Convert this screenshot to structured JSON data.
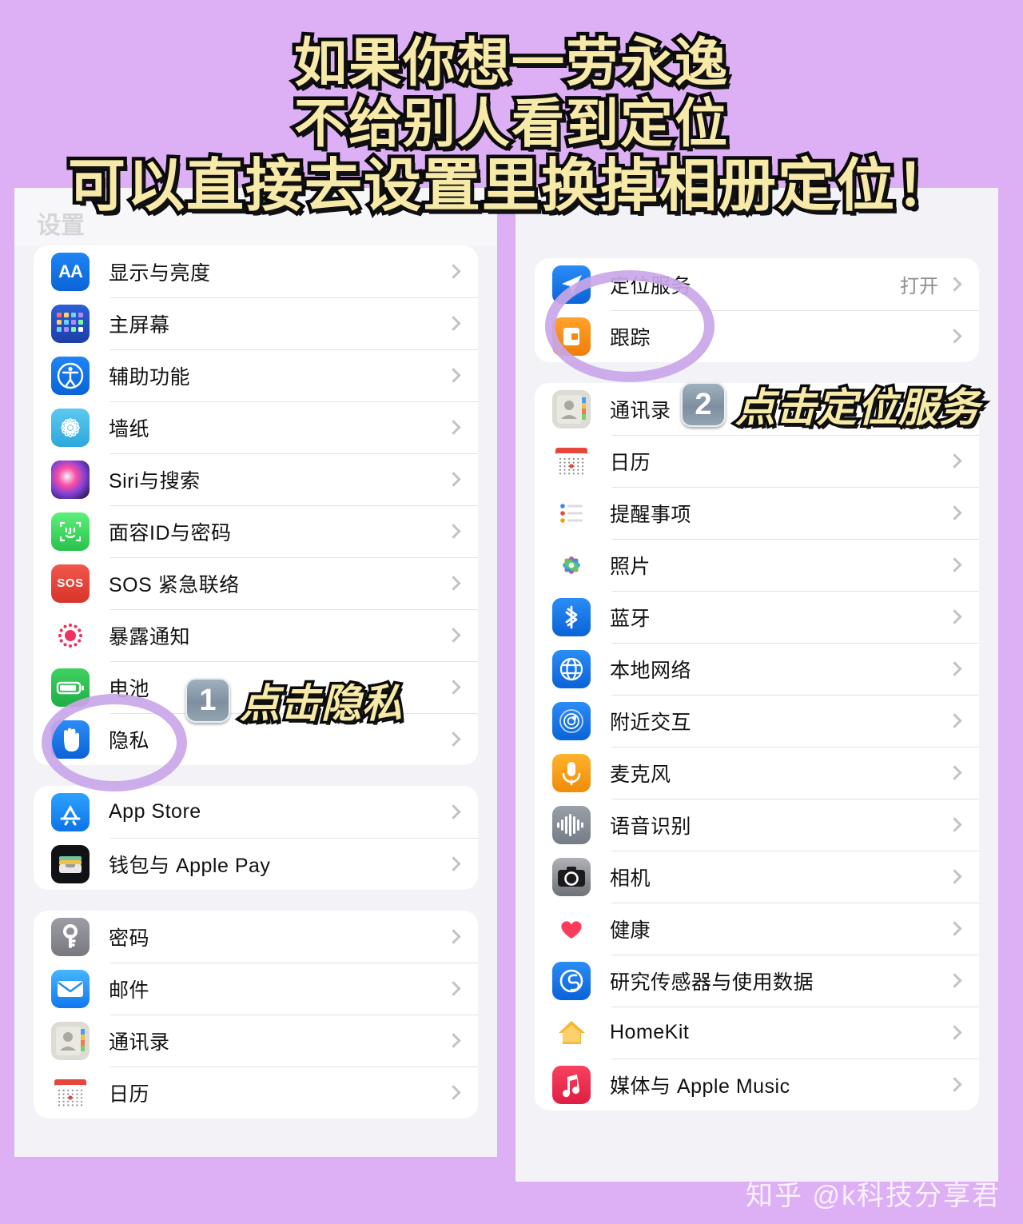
{
  "title": {
    "lines": [
      "如果你想一劳永逸",
      "不给别人看到定位",
      "可以直接去设置里换掉相册定位！"
    ]
  },
  "watermark": "知乎 @k科技分享君",
  "left_panel": {
    "header": "设置",
    "groups": [
      {
        "rows": [
          {
            "label": "显示与亮度",
            "icon": "display-brightness-icon",
            "value": ""
          },
          {
            "label": "主屏幕",
            "icon": "home-screen-icon",
            "value": ""
          },
          {
            "label": "辅助功能",
            "icon": "accessibility-icon",
            "value": ""
          },
          {
            "label": "墙纸",
            "icon": "wallpaper-icon",
            "value": ""
          },
          {
            "label": "Siri与搜索",
            "icon": "siri-icon",
            "value": ""
          },
          {
            "label": "面容ID与密码",
            "icon": "face-id-icon",
            "value": ""
          },
          {
            "label": "SOS 紧急联络",
            "icon": "sos-icon",
            "value": ""
          },
          {
            "label": "暴露通知",
            "icon": "exposure-notification-icon",
            "value": ""
          },
          {
            "label": "电池",
            "icon": "battery-icon",
            "value": ""
          },
          {
            "label": "隐私",
            "icon": "privacy-hand-icon",
            "value": ""
          }
        ]
      },
      {
        "rows": [
          {
            "label": "App Store",
            "icon": "app-store-icon",
            "value": ""
          },
          {
            "label": "钱包与 Apple Pay",
            "icon": "wallet-icon",
            "value": ""
          }
        ]
      },
      {
        "rows": [
          {
            "label": "密码",
            "icon": "passwords-key-icon",
            "value": ""
          },
          {
            "label": "邮件",
            "icon": "mail-icon",
            "value": ""
          },
          {
            "label": "通讯录",
            "icon": "contacts-icon",
            "value": ""
          },
          {
            "label": "日历",
            "icon": "calendar-icon",
            "value": ""
          }
        ]
      }
    ]
  },
  "right_panel": {
    "groups": [
      {
        "rows": [
          {
            "label": "定位服务",
            "icon": "location-services-icon",
            "value": "打开"
          },
          {
            "label": "跟踪",
            "icon": "tracking-icon",
            "value": ""
          }
        ]
      },
      {
        "rows": [
          {
            "label": "通讯录",
            "icon": "contacts-icon",
            "value": ""
          },
          {
            "label": "日历",
            "icon": "calendar-icon",
            "value": ""
          },
          {
            "label": "提醒事项",
            "icon": "reminders-icon",
            "value": ""
          },
          {
            "label": "照片",
            "icon": "photos-icon",
            "value": ""
          },
          {
            "label": "蓝牙",
            "icon": "bluetooth-icon",
            "value": ""
          },
          {
            "label": "本地网络",
            "icon": "local-network-icon",
            "value": ""
          },
          {
            "label": "附近交互",
            "icon": "nearby-interactions-icon",
            "value": ""
          },
          {
            "label": "麦克风",
            "icon": "microphone-icon",
            "value": ""
          },
          {
            "label": "语音识别",
            "icon": "speech-recognition-icon",
            "value": ""
          },
          {
            "label": "相机",
            "icon": "camera-icon",
            "value": ""
          },
          {
            "label": "健康",
            "icon": "health-heart-icon",
            "value": ""
          },
          {
            "label": "研究传感器与使用数据",
            "icon": "research-sensor-icon",
            "value": ""
          },
          {
            "label": "HomeKit",
            "icon": "homekit-icon",
            "value": ""
          },
          {
            "label": "媒体与 Apple Music",
            "icon": "apple-music-icon",
            "value": ""
          }
        ]
      }
    ]
  },
  "annotations": {
    "step1": {
      "number": "1",
      "text": "点击隐私"
    },
    "step2": {
      "number": "2",
      "text": "点击定位服务"
    },
    "highlight_color": "#c9a6e8"
  }
}
